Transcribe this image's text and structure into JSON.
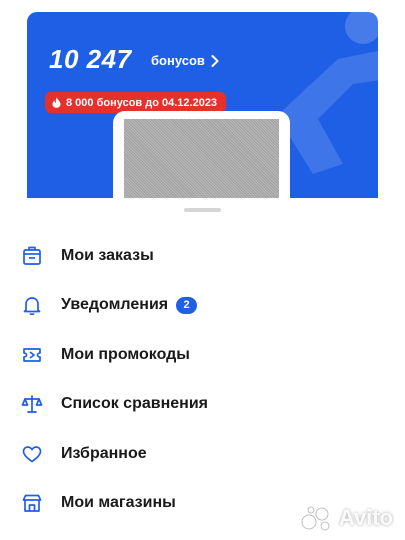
{
  "loyalty_card": {
    "bonus_amount": "10 247",
    "bonus_label": "бонусов",
    "expiry_text": "8 000 бонусов до 04.12.2023"
  },
  "menu": [
    {
      "label": "Мои заказы",
      "icon": "shop-box-icon"
    },
    {
      "label": "Уведомления",
      "icon": "bell-icon",
      "badge": "2"
    },
    {
      "label": "Мои промокоды",
      "icon": "ticket-icon"
    },
    {
      "label": "Список сравнения",
      "icon": "scales-icon"
    },
    {
      "label": "Избранное",
      "icon": "heart-icon"
    },
    {
      "label": "Мои магазины",
      "icon": "store-icon"
    }
  ],
  "watermark": {
    "text": "Avito"
  },
  "colors": {
    "brand_blue": "#1f5fe6",
    "badge_red": "#e5312b"
  }
}
